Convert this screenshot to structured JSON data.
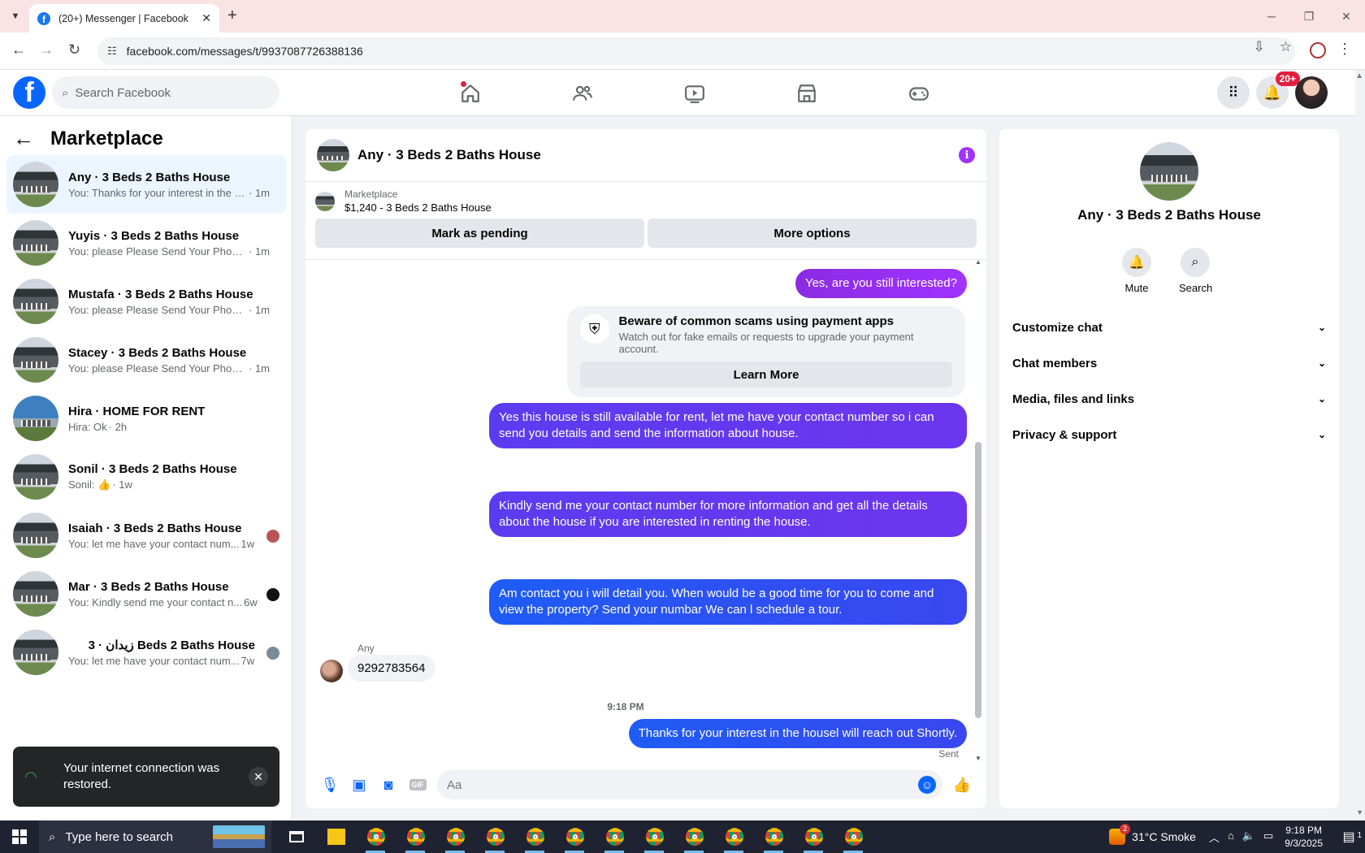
{
  "browser": {
    "tab_title": "(20+) Messenger | Facebook",
    "url": "facebook.com/messages/t/9937087726388136"
  },
  "fb": {
    "search_placeholder": "Search Facebook",
    "notif_badge": "20+"
  },
  "sidebar": {
    "title": "Marketplace",
    "conversations": [
      {
        "name": "Any · 3 Beds 2 Baths House",
        "snippet": "You: Thanks for your interest in the h...",
        "time": "· 1m",
        "active": true
      },
      {
        "name": "Yuyis · 3 Beds 2 Baths House",
        "snippet": "You: please Please Send Your Phone ...",
        "time": "· 1m"
      },
      {
        "name": "Mustafa · 3 Beds 2 Baths House",
        "snippet": "You: please Please Send Your Phone ...",
        "time": "· 1m"
      },
      {
        "name": "Stacey · 3 Beds 2 Baths House",
        "snippet": "You: please Please Send Your Phone ...",
        "time": "· 1m"
      },
      {
        "name": "Hira · HOME FOR RENT",
        "snippet": "Hira: Ok",
        "time": "· 2h"
      },
      {
        "name": "Sonil · 3 Beds 2 Baths House",
        "snippet": "Sonil: 👍",
        "time": "· 1w"
      },
      {
        "name": "Isaiah · 3 Beds 2 Baths House",
        "snippet": "You: let me have your contact num...",
        "time": "1w"
      },
      {
        "name": "Mar · 3 Beds 2 Baths House",
        "snippet": "You: Kindly send me your contact n...",
        "time": "6w"
      },
      {
        "name": "زيدان · 3 Beds 2 Baths House",
        "snippet": "You: let me have your contact num...",
        "time": "7w"
      }
    ]
  },
  "toast": {
    "message": "Your internet connection was restored."
  },
  "chat": {
    "title": "Any · 3 Beds 2 Baths House",
    "listing_source": "Marketplace",
    "listing_detail": "$1,240 - 3 Beds 2 Baths House",
    "mark_pending": "Mark as pending",
    "more_options": "More options",
    "messages": {
      "m1": "Yes, are you still interested?",
      "scam_title": "Beware of common scams using payment apps",
      "scam_sub": "Watch out for fake emails or requests to upgrade your payment account.",
      "learn_more": "Learn More",
      "m2": "Yes this house is still available for rent, let me have your contact number so i can send you details and send the information about house.",
      "m3": "Kindly send me your contact number for more information and get all the details about the house if you are interested in renting the house.",
      "m4": "Am contact you i will detail you.  When would be a good time for you to come and view the property? Send your numbar We can l schedule a tour.",
      "sender": "Any",
      "in1": "9292783564",
      "time": "9:18 PM",
      "m5": "Thanks for your interest in the housel will reach out Shortly.",
      "status": "Sent"
    },
    "composer_placeholder": "Aa",
    "gif_label": "GIF"
  },
  "info": {
    "title": "Any · 3 Beds 2 Baths House",
    "mute": "Mute",
    "search": "Search",
    "sections": [
      "Customize chat",
      "Chat members",
      "Media, files and links",
      "Privacy & support"
    ]
  },
  "taskbar": {
    "search_placeholder": "Type here to search",
    "weather": "31°C  Smoke",
    "weather_badge": "2",
    "time": "9:18 PM",
    "date": "9/3/2025",
    "notif_count": "1"
  }
}
